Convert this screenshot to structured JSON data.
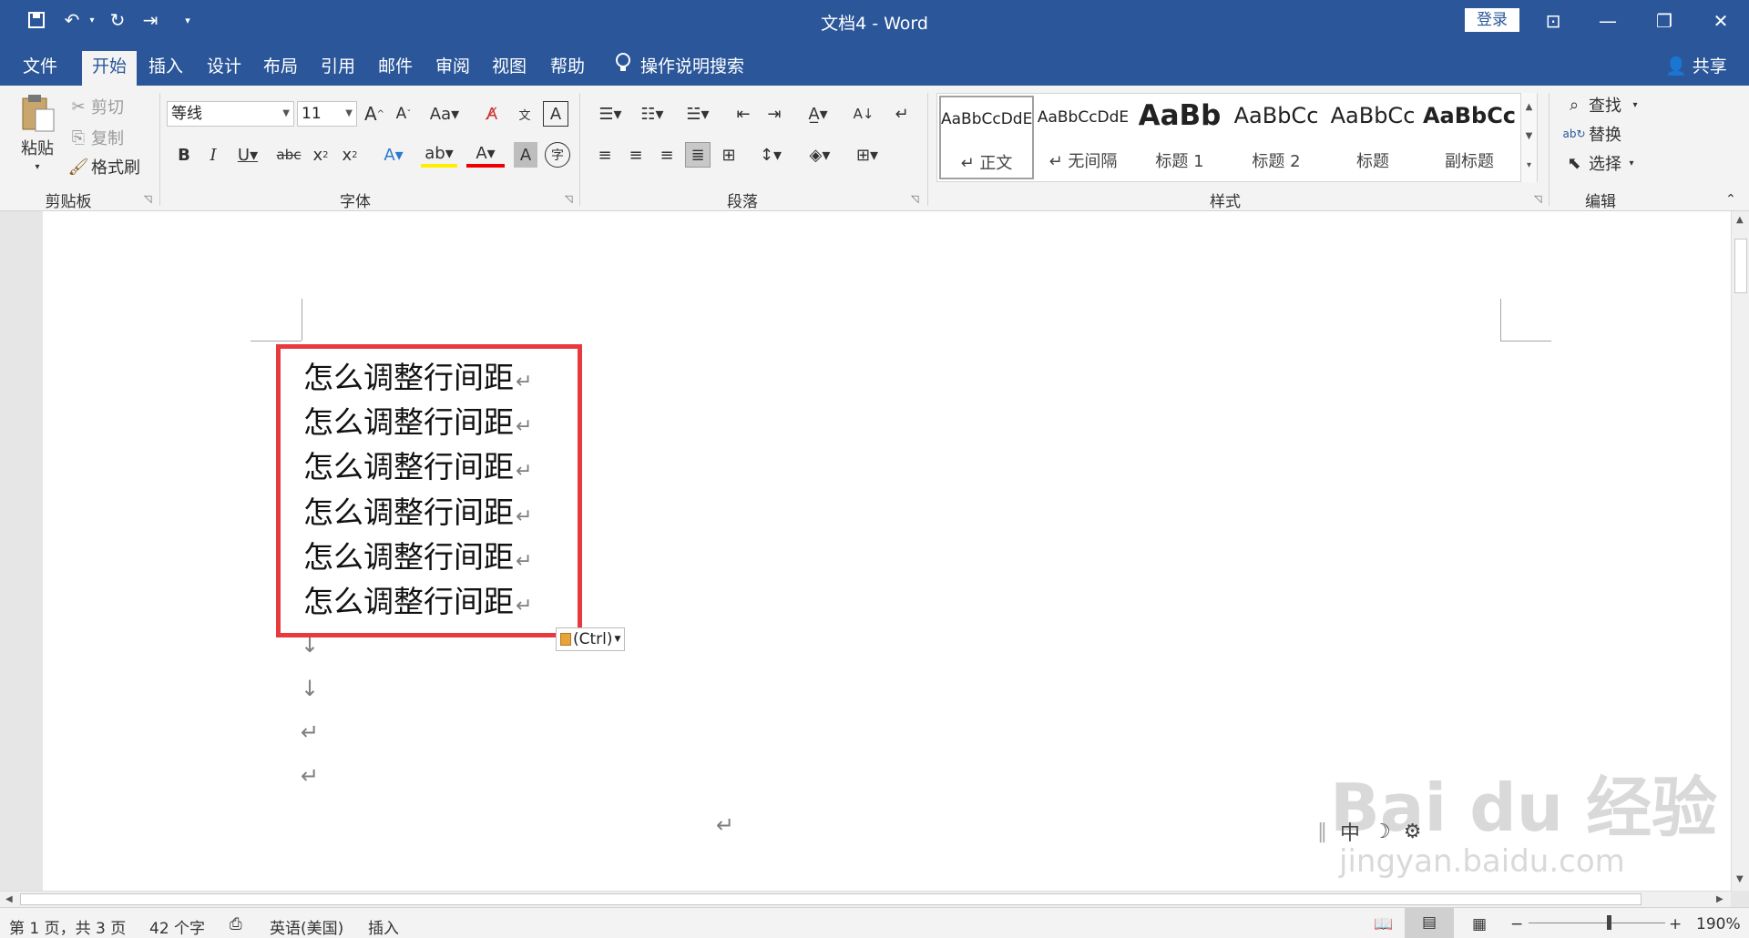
{
  "titlebar": {
    "doc_title": "文档4  -  Word",
    "login": "登录"
  },
  "menu": {
    "file": "文件",
    "tabs": [
      "开始",
      "插入",
      "设计",
      "布局",
      "引用",
      "邮件",
      "审阅",
      "视图",
      "帮助"
    ],
    "tell_me": "操作说明搜索",
    "share": "共享"
  },
  "ribbon": {
    "clipboard": {
      "paste": "粘贴",
      "cut": "剪切",
      "copy": "复制",
      "format_painter": "格式刷",
      "label": "剪贴板"
    },
    "font": {
      "font_name": "等线",
      "font_size": "11",
      "label": "字体"
    },
    "paragraph": {
      "label": "段落"
    },
    "styles": {
      "label": "样式",
      "items": [
        {
          "sample": "AaBbCcDdE",
          "name": "↵ 正文"
        },
        {
          "sample": "AaBbCcDdE",
          "name": "↵ 无间隔"
        },
        {
          "sample": "AaBb",
          "name": "标题 1"
        },
        {
          "sample": "AaBbCc",
          "name": "标题 2"
        },
        {
          "sample": "AaBbCc",
          "name": "标题"
        },
        {
          "sample": "AaBbCc",
          "name": "副标题"
        }
      ]
    },
    "editing": {
      "find": "查找",
      "replace": "替换",
      "select": "选择",
      "label": "编辑"
    }
  },
  "document": {
    "lines": [
      "怎么调整行间距",
      "怎么调整行间距",
      "怎么调整行间距",
      "怎么调整行间距",
      "怎么调整行间距",
      "怎么调整行间距"
    ],
    "paste_options": "(Ctrl)"
  },
  "statusbar": {
    "page": "第 1 页，共 3 页",
    "words": "42 个字",
    "language": "英语(美国)",
    "mode": "插入",
    "zoom": "190%"
  },
  "watermark": {
    "main": "Bai du 经验",
    "sub": "jingyan.baidu.com",
    "ime": "中"
  },
  "colors": {
    "brand": "#2b579a",
    "highlight_box": "#e8393e"
  }
}
